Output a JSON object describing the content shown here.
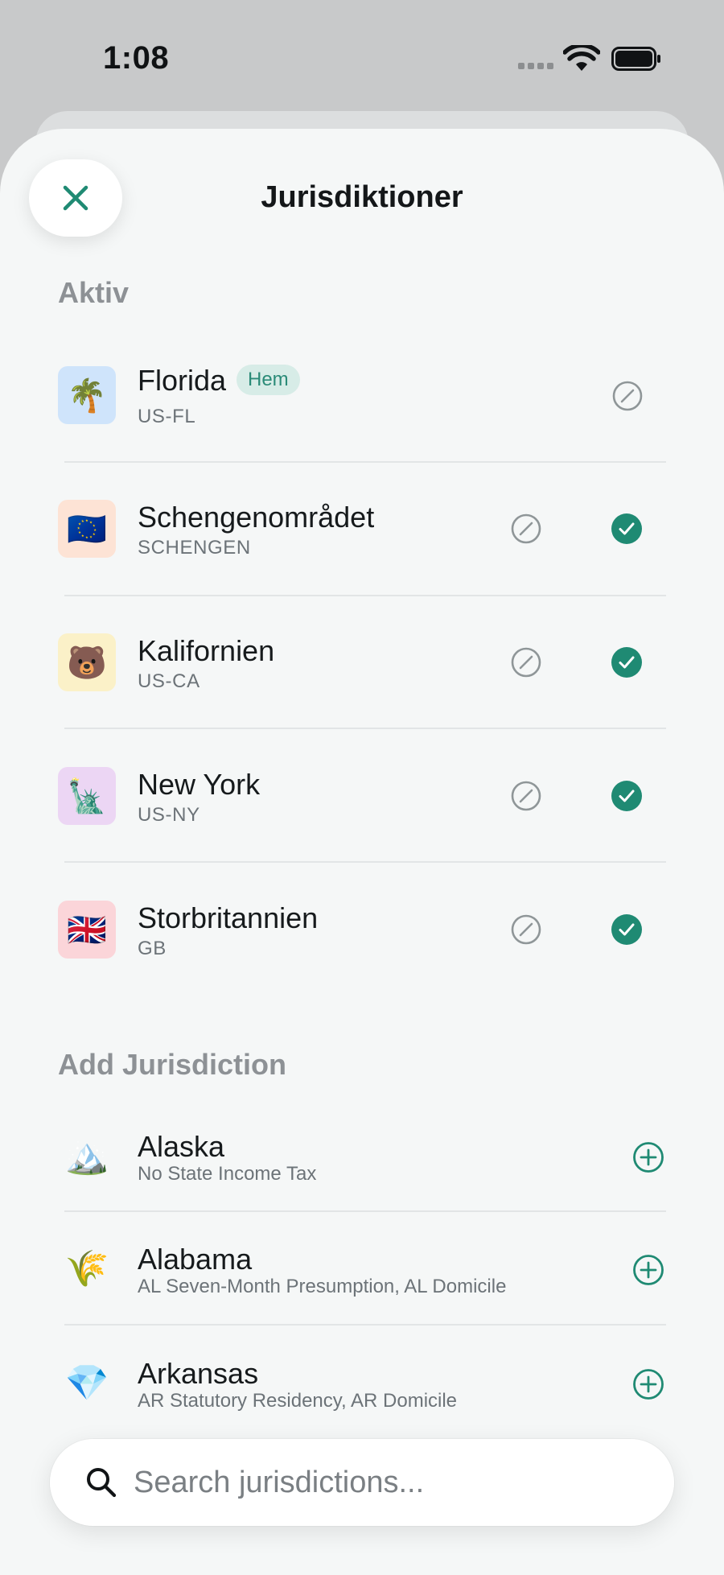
{
  "status_bar": {
    "time": "1:08"
  },
  "header": {
    "title": "Jurisdiktioner"
  },
  "active_section": {
    "title": "Aktiv",
    "items": [
      {
        "name": "Florida",
        "code": "US-FL",
        "emoji": "🌴",
        "tile_color": "#cfe4fb",
        "badge": "Hem",
        "selected": false
      },
      {
        "name": "Schengenområdet",
        "code": "SCHENGEN",
        "emoji": "🇪🇺",
        "tile_color": "#fde3d5",
        "selected": true
      },
      {
        "name": "Kalifornien",
        "code": "US-CA",
        "emoji": "🐻",
        "tile_color": "#fbf1c8",
        "selected": true
      },
      {
        "name": "New York",
        "code": "US-NY",
        "emoji": "🗽",
        "tile_color": "#ecd6f4",
        "selected": true
      },
      {
        "name": "Storbritannien",
        "code": "GB",
        "emoji": "🇬🇧",
        "tile_color": "#fbd5d9",
        "selected": true
      }
    ]
  },
  "add_section": {
    "title": "Add Jurisdiction",
    "items": [
      {
        "name": "Alaska",
        "subtitle": "No State Income Tax",
        "emoji": "🏔️"
      },
      {
        "name": "Alabama",
        "subtitle": "AL Seven-Month Presumption, AL Domicile",
        "emoji": "🌾"
      },
      {
        "name": "Arkansas",
        "subtitle": "AR Statutory Residency, AR Domicile",
        "emoji": "💎"
      }
    ]
  },
  "search": {
    "placeholder": "Search jurisdictions..."
  },
  "colors": {
    "accent": "#1f8a73",
    "muted": "#8d9195",
    "edit_icon": "#8f9698"
  }
}
